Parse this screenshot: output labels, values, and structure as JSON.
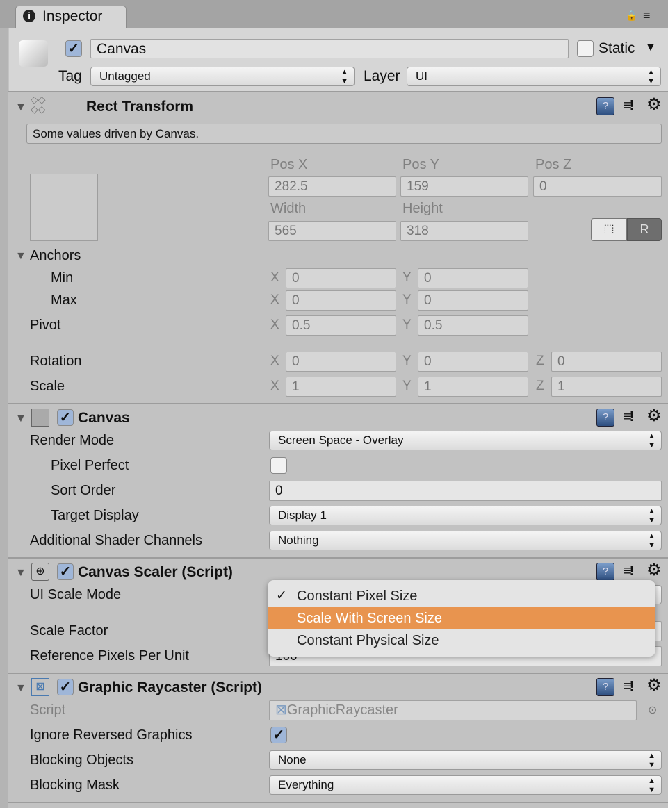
{
  "tab": {
    "icon": "info-icon",
    "title": "Inspector"
  },
  "header": {
    "active": true,
    "name": "Canvas",
    "static_label": "Static",
    "static": false,
    "tag_label": "Tag",
    "tag": "Untagged",
    "layer_label": "Layer",
    "layer": "UI"
  },
  "rect_transform": {
    "title": "Rect Transform",
    "help": "Some values driven by Canvas.",
    "pos_x_label": "Pos X",
    "pos_y_label": "Pos Y",
    "pos_z_label": "Pos Z",
    "pos_x": "282.5",
    "pos_y": "159",
    "pos_z": "0",
    "width_label": "Width",
    "height_label": "Height",
    "width": "565",
    "height": "318",
    "raw_button": "R",
    "anchors_label": "Anchors",
    "min_label": "Min",
    "max_label": "Max",
    "pivot_label": "Pivot",
    "rotation_label": "Rotation",
    "scale_label": "Scale",
    "x": "X",
    "y": "Y",
    "z": "Z",
    "min_x": "0",
    "min_y": "0",
    "max_x": "0",
    "max_y": "0",
    "pivot_x": "0.5",
    "pivot_y": "0.5",
    "rot_x": "0",
    "rot_y": "0",
    "rot_z": "0",
    "scale_x": "1",
    "scale_y": "1",
    "scale_z": "1"
  },
  "canvas": {
    "title": "Canvas",
    "enabled": true,
    "render_mode_label": "Render Mode",
    "render_mode": "Screen Space - Overlay",
    "pixel_perfect_label": "Pixel Perfect",
    "pixel_perfect": false,
    "sort_order_label": "Sort Order",
    "sort_order": "0",
    "target_display_label": "Target Display",
    "target_display": "Display 1",
    "shader_channels_label": "Additional Shader Channels",
    "shader_channels": "Nothing"
  },
  "canvas_scaler": {
    "title": "Canvas Scaler (Script)",
    "enabled": true,
    "ui_scale_mode_label": "UI Scale Mode",
    "scale_factor_label": "Scale Factor",
    "ref_ppu_label": "Reference Pixels Per Unit",
    "ref_ppu": "100",
    "popup": {
      "options": [
        "Constant Pixel Size",
        "Scale With Screen Size",
        "Constant Physical Size"
      ],
      "checked": "Constant Pixel Size",
      "highlighted": "Scale With Screen Size",
      "highlight_color": "#e8944f",
      "check": "✓"
    }
  },
  "graphic_raycaster": {
    "title": "Graphic Raycaster (Script)",
    "enabled": true,
    "script_label": "Script",
    "script": "GraphicRaycaster",
    "ignore_reversed_label": "Ignore Reversed Graphics",
    "ignore_reversed": true,
    "blocking_objects_label": "Blocking Objects",
    "blocking_objects": "None",
    "blocking_mask_label": "Blocking Mask",
    "blocking_mask": "Everything"
  }
}
